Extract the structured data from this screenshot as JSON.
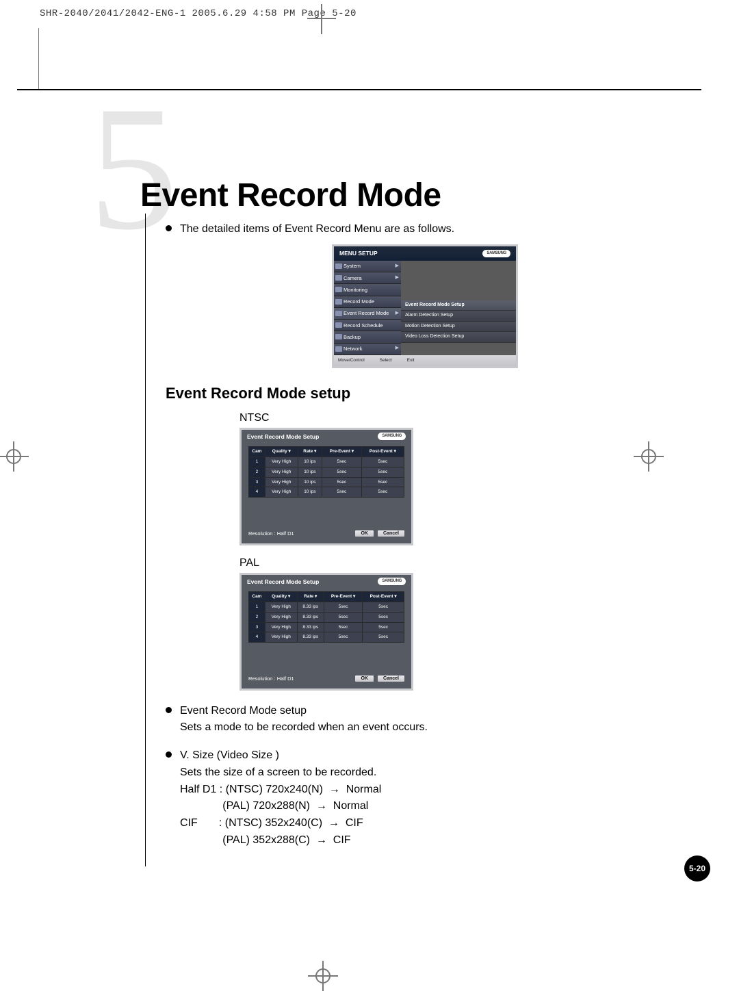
{
  "header_text": "SHR-2040/2041/2042-ENG-1  2005.6.29  4:58 PM  Page 5-20",
  "chapter_number": "5",
  "title": "Event Record Mode",
  "intro_bullet": "The detailed items of Event Record Menu are as follows.",
  "menu_setup": {
    "title": "MENU SETUP",
    "brand": "SAMSUNG",
    "items": [
      {
        "label": "System",
        "arrow": "▶"
      },
      {
        "label": "Camera",
        "arrow": "▶"
      },
      {
        "label": "Monitoring",
        "arrow": ""
      },
      {
        "label": "Record Mode",
        "arrow": ""
      },
      {
        "label": "Event Record Mode",
        "arrow": "▶"
      },
      {
        "label": "Record Schedule",
        "arrow": ""
      },
      {
        "label": "Backup",
        "arrow": ""
      },
      {
        "label": "Network",
        "arrow": "▶"
      }
    ],
    "sub_items": [
      "Event Record Mode Setup",
      "Alarm Detection Setup",
      "Motion Detection Setup",
      "Video Loss Detection Setup"
    ],
    "footer": {
      "move": "Move/Control",
      "select": "Select",
      "exit": "Exit"
    }
  },
  "section_heading": "Event Record Mode setup",
  "ntsc_label": "NTSC",
  "pal_label": "PAL",
  "setup_panel": {
    "title": "Event Record Mode Setup",
    "brand": "SAMSUNG",
    "headers": [
      "Cam",
      "Quality ▾",
      "Rate ▾",
      "Pre-Event ▾",
      "Post-Event ▾"
    ],
    "ntsc_rows": [
      [
        "1",
        "Very High",
        "10 ips",
        "5sec",
        "5sec"
      ],
      [
        "2",
        "Very High",
        "10 ips",
        "5sec",
        "5sec"
      ],
      [
        "3",
        "Very High",
        "10 ips",
        "5sec",
        "5sec"
      ],
      [
        "4",
        "Very High",
        "10 ips",
        "5sec",
        "5sec"
      ]
    ],
    "pal_rows": [
      [
        "1",
        "Very High",
        "8.33 ips",
        "5sec",
        "5sec"
      ],
      [
        "2",
        "Very High",
        "8.33 ips",
        "5sec",
        "5sec"
      ],
      [
        "3",
        "Very High",
        "8.33 ips",
        "5sec",
        "5sec"
      ],
      [
        "4",
        "Very High",
        "8.33 ips",
        "5sec",
        "5sec"
      ]
    ],
    "resolution": "Resolution : Half D1",
    "ok": "OK",
    "cancel": "Cancel"
  },
  "bullets": [
    {
      "title": "Event Record Mode setup",
      "lines": [
        "Sets a mode to be recorded when an event occurs."
      ]
    },
    {
      "title": "V. Size (Video Size )",
      "lines": [
        "Sets the size of a screen to be recorded.",
        "Half D1 : (NTSC) 720x240(N)  →  Normal",
        "              (PAL) 720x288(N)  →  Normal",
        "CIF       : (NTSC) 352x240(C)  →  CIF",
        "              (PAL) 352x288(C)  →  CIF"
      ]
    }
  ],
  "page_number": "5-20"
}
